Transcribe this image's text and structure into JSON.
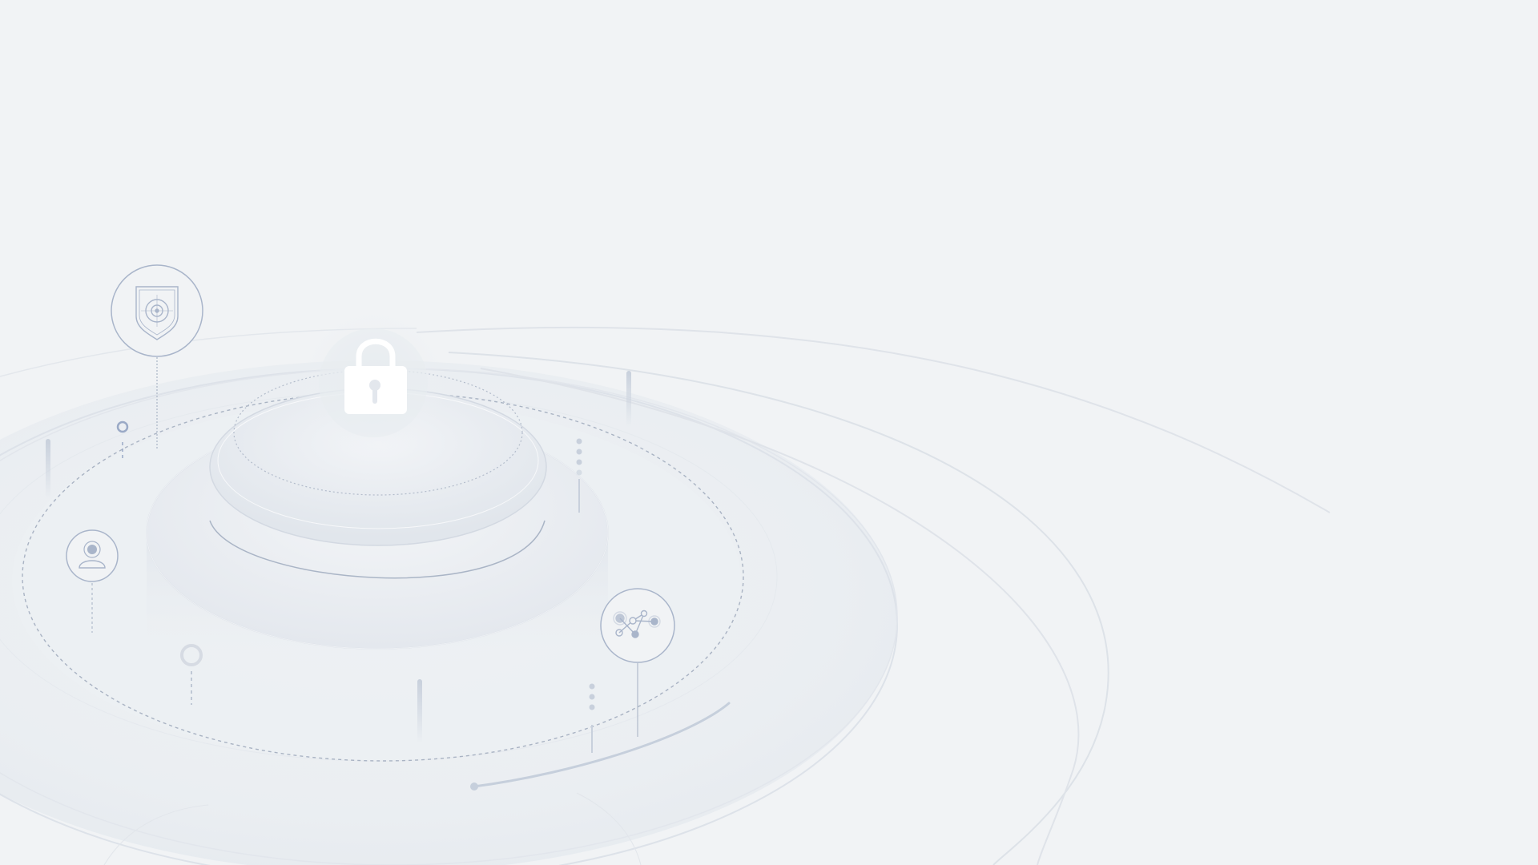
{
  "scene": {
    "background_color": "#f1f3f5",
    "accent_color": "#9aa9c6",
    "platform_color": "#e6eaf0",
    "icons": {
      "center": "padlock-icon",
      "top_left": "shield-icon",
      "left": "user-icon",
      "right": "network-graph-icon"
    }
  }
}
